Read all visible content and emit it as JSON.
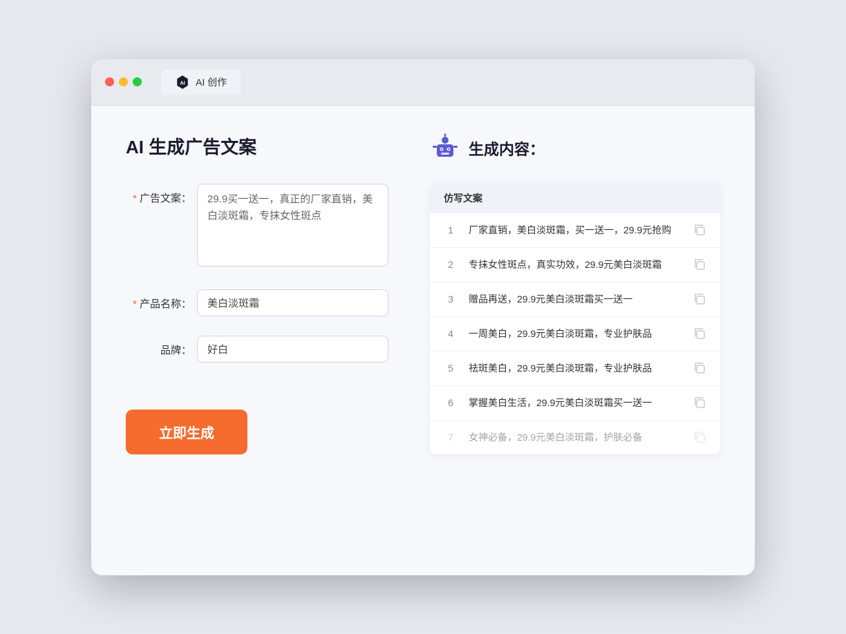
{
  "browser": {
    "tab_label": "AI 创作"
  },
  "left": {
    "page_title": "AI 生成广告文案",
    "form": {
      "ad_copy_label": "广告文案：",
      "ad_copy_required": "*",
      "ad_copy_value": "29.9买一送一，真正的厂家直销，美白淡斑霜，专抹女性斑点",
      "product_name_label": "产品名称：",
      "product_name_required": "*",
      "product_name_value": "美白淡斑霜",
      "brand_label": "品牌：",
      "brand_value": "好白",
      "generate_btn": "立即生成"
    }
  },
  "right": {
    "result_title": "生成内容：",
    "table_header": "仿写文案",
    "rows": [
      {
        "num": "1",
        "text": "厂家直销，美白淡斑霜，买一送一，29.9元抢购",
        "muted": false
      },
      {
        "num": "2",
        "text": "专抹女性斑点，真实功效，29.9元美白淡斑霜",
        "muted": false
      },
      {
        "num": "3",
        "text": "赠品再送，29.9元美白淡斑霜买一送一",
        "muted": false
      },
      {
        "num": "4",
        "text": "一周美白，29.9元美白淡斑霜，专业护肤品",
        "muted": false
      },
      {
        "num": "5",
        "text": "祛斑美白，29.9元美白淡斑霜，专业护肤品",
        "muted": false
      },
      {
        "num": "6",
        "text": "掌握美白生活，29.9元美白淡斑霜买一送一",
        "muted": false
      },
      {
        "num": "7",
        "text": "女神必备，29.9元美白淡斑霜，护肤必备",
        "muted": true
      }
    ]
  }
}
